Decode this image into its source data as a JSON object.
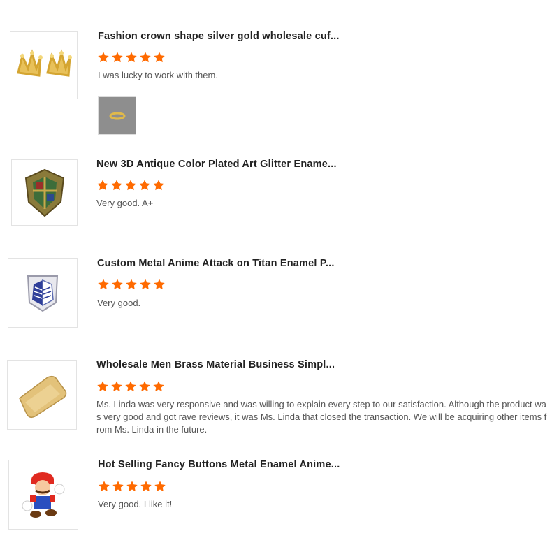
{
  "accent_color": "#ff6a00",
  "reviews": [
    {
      "title": "Fashion crown shape silver gold wholesale cuf...",
      "rating": 5,
      "comment": "I was lucky to work with them.",
      "image": "gold-crown-cufflinks-image",
      "has_photo": true,
      "photo": "customer-photo-ring"
    },
    {
      "title": "New 3D Antique Color Plated Art Glitter Ename...",
      "rating": 5,
      "comment": "Very good. A+",
      "image": "crest-enamel-pin-image"
    },
    {
      "title": "Custom Metal Anime Attack on Titan Enamel P...",
      "rating": 5,
      "comment": "Very good.",
      "image": "wings-of-freedom-pin-image"
    },
    {
      "title": "Wholesale Men Brass Material Business Simpl...",
      "rating": 5,
      "comment": "Ms. Linda was very responsive and was willing to explain every step to our satisfaction.  Although the product was very good and got rave reviews, it was Ms. Linda that closed the transaction.  We will be acquiring other items from Ms. Linda in the future.",
      "image": "brass-money-clip-image"
    },
    {
      "title": "Hot Selling Fancy Buttons Metal Enamel Anime...",
      "rating": 5,
      "comment": "Very good.  I like it!",
      "image": "mario-enamel-pin-image"
    }
  ]
}
